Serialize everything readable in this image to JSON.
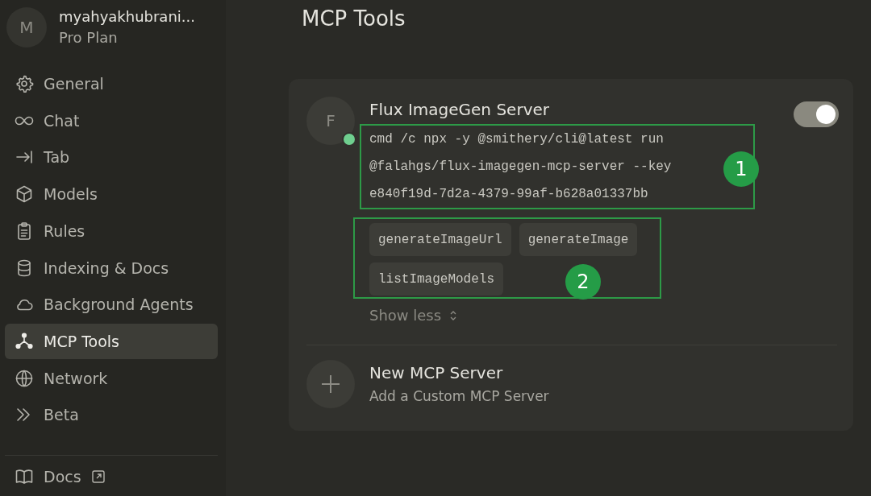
{
  "user": {
    "avatar_initial": "M",
    "name": "myahyakhubrani...",
    "plan": "Pro Plan"
  },
  "sidebar": {
    "items": [
      {
        "label": "General",
        "kind": "gear",
        "selected": false
      },
      {
        "label": "Chat",
        "kind": "infinity",
        "selected": false
      },
      {
        "label": "Tab",
        "kind": "tab",
        "selected": false
      },
      {
        "label": "Models",
        "kind": "cube",
        "selected": false
      },
      {
        "label": "Rules",
        "kind": "clipboard",
        "selected": false
      },
      {
        "label": "Indexing & Docs",
        "kind": "database",
        "selected": false
      },
      {
        "label": "Background Agents",
        "kind": "cloud",
        "selected": false
      },
      {
        "label": "MCP Tools",
        "kind": "nodes",
        "selected": true
      },
      {
        "label": "Network",
        "kind": "globe",
        "selected": false
      },
      {
        "label": "Beta",
        "kind": "chevrons",
        "selected": false
      }
    ],
    "footer_link": {
      "label": "Docs",
      "kind": "book"
    }
  },
  "page": {
    "title": "MCP Tools"
  },
  "server": {
    "avatar_initial": "F",
    "name": "Flux ImageGen Server",
    "connected": true,
    "on": true,
    "command": {
      "annotation": "1",
      "lines": [
        "cmd /c npx -y @smithery/cli@latest run",
        "@falahgs/flux-imagegen-mcp-server --key",
        "e840f19d-7d2a-4379-99af-b628a01337bb"
      ]
    },
    "tools": {
      "annotation": "2",
      "items": [
        "generateImageUrl",
        "generateImage",
        "listImageModels"
      ]
    },
    "show_less": "Show less"
  },
  "new_server": {
    "title": "New MCP Server",
    "subtitle": "Add a Custom MCP Server"
  }
}
